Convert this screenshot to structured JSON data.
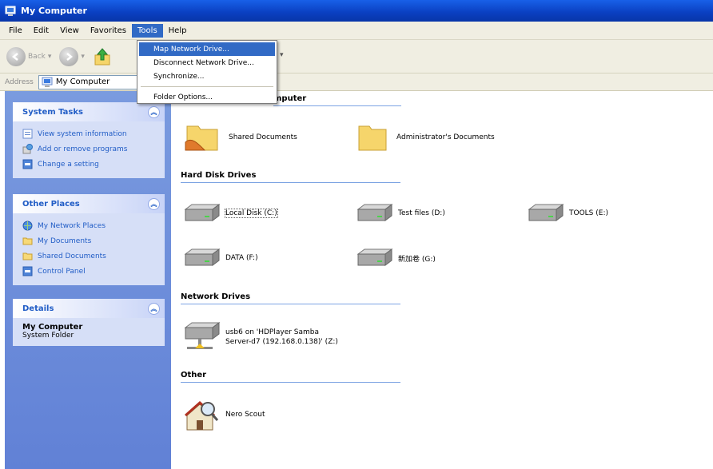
{
  "window": {
    "title": "My Computer"
  },
  "menu": {
    "items": [
      "File",
      "Edit",
      "View",
      "Favorites",
      "Tools",
      "Help"
    ],
    "active": "Tools"
  },
  "toolbar": {
    "back_label": "Back"
  },
  "address": {
    "label": "Address",
    "value": "My Computer"
  },
  "tools_menu": {
    "items": [
      "Map Network Drive...",
      "Disconnect Network Drive...",
      "Synchronize...",
      "Folder Options..."
    ]
  },
  "sidebar": {
    "system_tasks": {
      "title": "System Tasks",
      "links": [
        "View system information",
        "Add or remove programs",
        "Change a setting"
      ]
    },
    "other_places": {
      "title": "Other Places",
      "links": [
        "My Network Places",
        "My Documents",
        "Shared Documents",
        "Control Panel"
      ]
    },
    "details": {
      "title": "Details",
      "name": "My Computer",
      "type": "System Folder"
    }
  },
  "main": {
    "groups": {
      "files": "mputer",
      "hard_disk": "Hard Disk Drives",
      "network": "Network Drives",
      "other": "Other"
    },
    "files": [
      "Shared Documents",
      "Administrator's Documents"
    ],
    "drives": [
      "Local Disk (C:)",
      "Test files (D:)",
      "TOOLS (E:)",
      "DATA (F:)",
      "新加卷 (G:)"
    ],
    "network_drives": {
      "line1": "usb6 on 'HDPlayer Samba",
      "line2": "Server-d7 (192.168.0.138)' (Z:)"
    },
    "other_items": [
      "Nero Scout"
    ]
  }
}
